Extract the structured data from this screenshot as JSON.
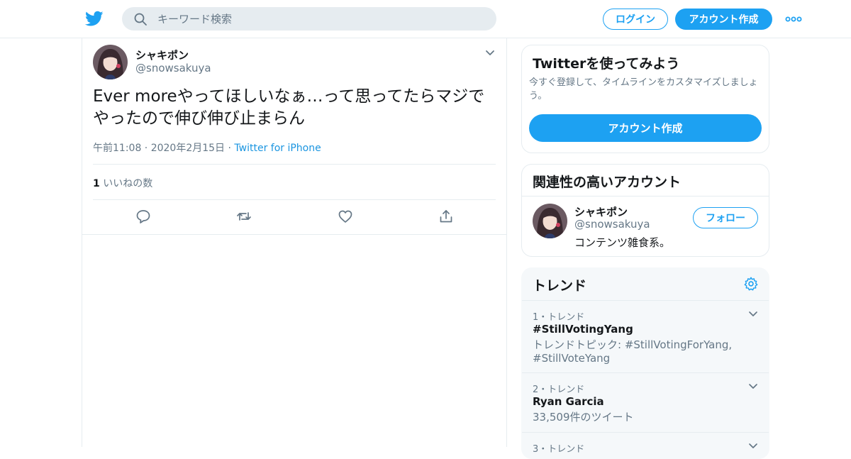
{
  "header": {
    "search_placeholder": "キーワード検索",
    "login_label": "ログイン",
    "signup_label": "アカウント作成"
  },
  "tweet": {
    "display_name": "シャキポン",
    "handle": "@snowsakuya",
    "text_line1": "Ever moreやってほしいなぁ…って思ってたらマジで",
    "text_line2": "やったので伸び伸び止まらん",
    "time": "午前11:08 · 2020年2月15日 · ",
    "source": "Twitter for iPhone",
    "likes_count": "1",
    "likes_label": " いいねの数"
  },
  "signup_card": {
    "title": "Twitterを使ってみよう",
    "description": "今すぐ登録して、タイムラインをカスタマイズしましょう。",
    "button_label": "アカウント作成"
  },
  "related_card": {
    "title": "関連性の高いアカウント",
    "name": "シャキポン",
    "handle": "@snowsakuya",
    "bio": "コンテンツ雑食系。",
    "follow_label": "フォロー"
  },
  "trends": {
    "title": "トレンド",
    "items": [
      {
        "meta": "1・トレンド",
        "name": "#StillVotingYang",
        "sub": "トレンドトピック: #StillVotingForYang, #StillVoteYang"
      },
      {
        "meta": "2・トレンド",
        "name": "Ryan Garcia",
        "sub": "33,509件のツイート"
      },
      {
        "meta": "3・トレンド",
        "name": "",
        "sub": ""
      }
    ]
  },
  "colors": {
    "brand": "#1da1f2",
    "link": "#1b95e0",
    "muted": "#657786",
    "border": "#e6ecf0"
  }
}
